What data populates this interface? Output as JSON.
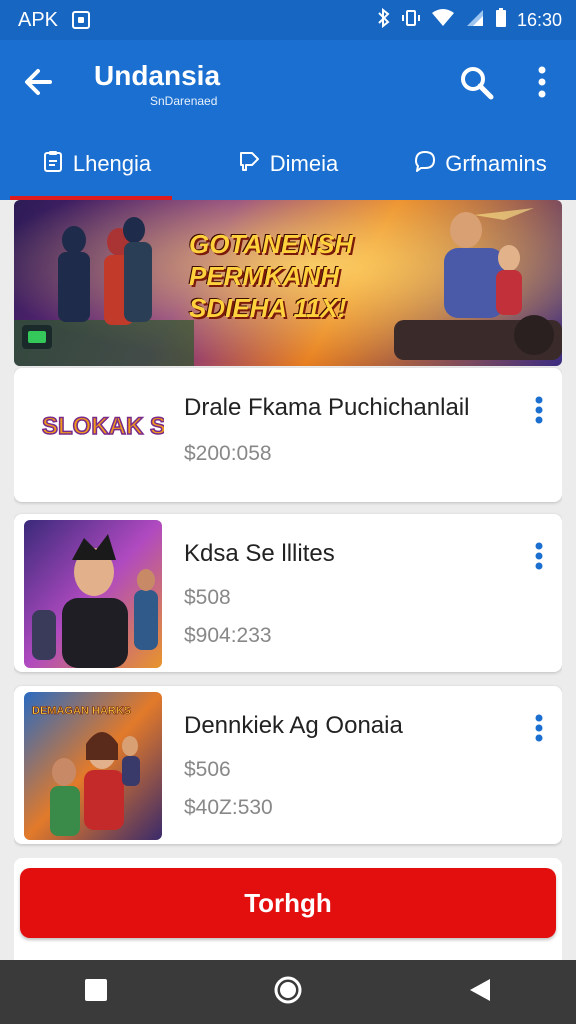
{
  "status_bar": {
    "carrier": "APK",
    "time": "16:30"
  },
  "app_bar": {
    "title": "Undansia",
    "subtitle": "SnDarenaed"
  },
  "tabs": [
    {
      "label": "Lhengia",
      "icon": "clipboard-icon",
      "active": true
    },
    {
      "label": "Dimeia",
      "icon": "tag-icon",
      "active": false
    },
    {
      "label": "Grfnamins",
      "icon": "chat-icon",
      "active": false
    }
  ],
  "banner": {
    "headline_lines": [
      "GOTANENSH",
      "PERMKANH",
      "SDIEHA 11X!"
    ]
  },
  "items": [
    {
      "name": "Drale Fkama Puchichanlail",
      "price": "",
      "price_alt": "$200:058",
      "thumb_text": "SLOKAK SOEMALAS"
    },
    {
      "name": "Kdsa Se lllites",
      "price": "$508",
      "price_alt": "$904:233"
    },
    {
      "name": "Dennkiek Ag Oonaia",
      "price": "$506",
      "price_alt": "$40Z:530",
      "thumb_text": "DEMAGAN HARKS"
    }
  ],
  "cta": {
    "label": "Torhgh"
  },
  "colors": {
    "primary": "#1a6fd0",
    "accent_red": "#e30f0f",
    "kebab_blue": "#1a6fd0"
  }
}
